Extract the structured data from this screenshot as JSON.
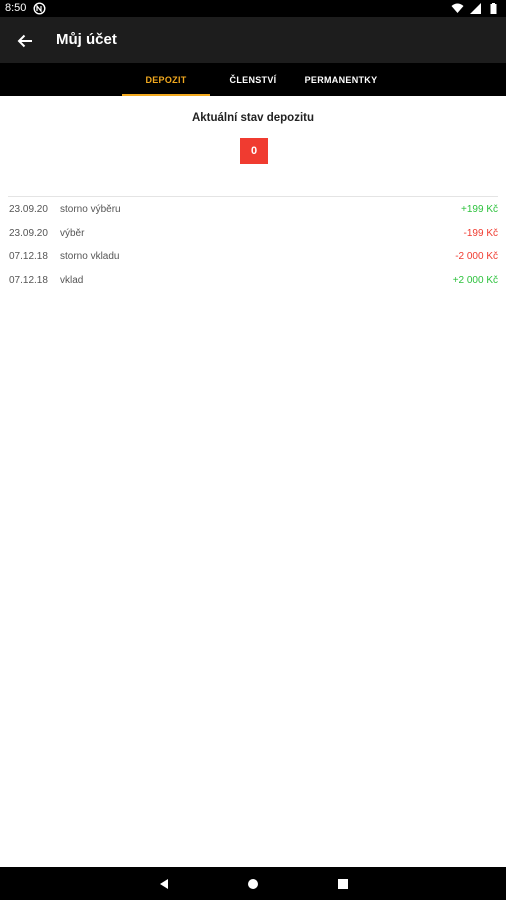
{
  "status_bar": {
    "time": "8:50"
  },
  "app_bar": {
    "title": "Můj účet"
  },
  "tabs": [
    {
      "label": "DEPOZIT",
      "active": true
    },
    {
      "label": "ČLENSTVÍ",
      "active": false
    },
    {
      "label": "PERMANENTKY",
      "active": false
    }
  ],
  "balance": {
    "title": "Aktuální stav depozitu",
    "value": "0"
  },
  "transactions": [
    {
      "date": "23.09.20",
      "desc": "storno výběru",
      "amount": "+199 Kč",
      "sign": "positive"
    },
    {
      "date": "23.09.20",
      "desc": "výběr",
      "amount": "-199 Kč",
      "sign": "negative"
    },
    {
      "date": "07.12.18",
      "desc": "storno vkladu",
      "amount": "-2 000 Kč",
      "sign": "negative"
    },
    {
      "date": "07.12.18",
      "desc": "vklad",
      "amount": "+2 000 Kč",
      "sign": "positive"
    }
  ],
  "colors": {
    "accent": "#f2a91f",
    "positive": "#2dc23d",
    "negative": "#f03b30",
    "badge": "#f03b30"
  },
  "icons": {
    "back": "arrow-left-icon",
    "wifi": "wifi-icon",
    "signal": "signal-icon",
    "battery": "battery-icon"
  }
}
